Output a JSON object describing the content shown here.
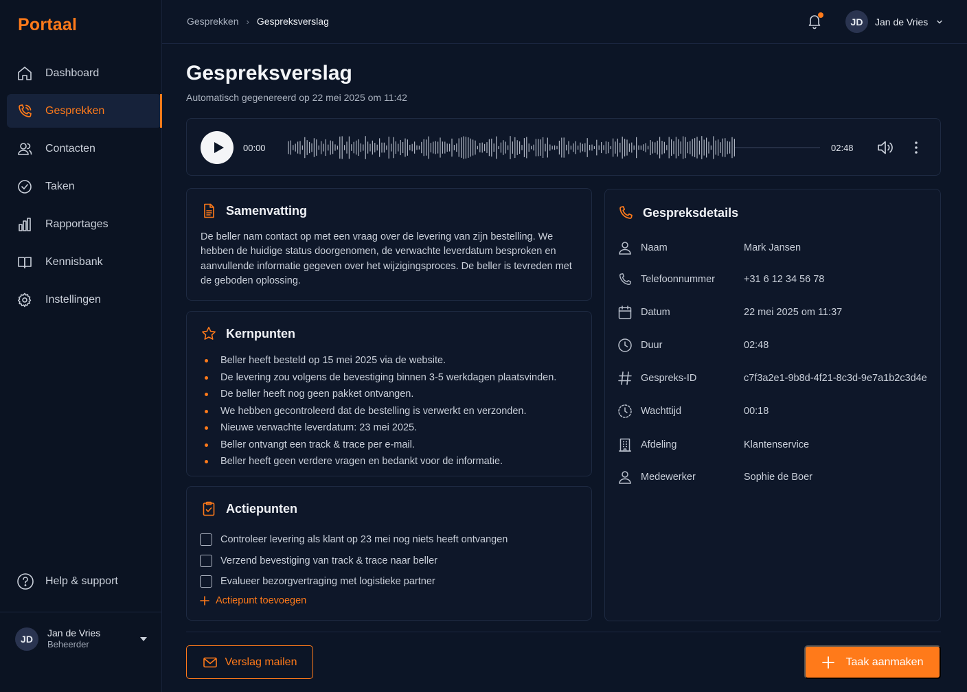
{
  "brand": "Portaal",
  "colors": {
    "accent": "#ff7a1a",
    "background": "#0c1526",
    "card": "#0e1729"
  },
  "sidebar": {
    "items": [
      {
        "label": "Dashboard",
        "icon": "home-icon",
        "active": false
      },
      {
        "label": "Gesprekken",
        "icon": "phone-call-icon",
        "active": true
      },
      {
        "label": "Contacten",
        "icon": "users-icon",
        "active": false
      },
      {
        "label": "Taken",
        "icon": "check-circle-icon",
        "active": false
      },
      {
        "label": "Rapportages",
        "icon": "bar-chart-icon",
        "active": false
      },
      {
        "label": "Kennisbank",
        "icon": "book-icon",
        "active": false
      },
      {
        "label": "Instellingen",
        "icon": "gear-icon",
        "active": false
      }
    ],
    "help": "Help & support",
    "user": {
      "initials": "JD",
      "name": "Jan de Vries",
      "role": "Beheerder"
    }
  },
  "topbar": {
    "breadcrumb": [
      "Gesprekken",
      "Gespreksverslag"
    ],
    "user": {
      "initials": "JD",
      "name": "Jan de Vries"
    }
  },
  "page": {
    "title": "Gespreksverslag",
    "subtitle": "Automatisch gegenereerd op 22 mei 2025 om 11:42"
  },
  "player": {
    "current_time": "00:00",
    "duration": "02:48",
    "progress": 0
  },
  "summary": {
    "title": "Samenvatting",
    "text": "De beller nam contact op met een vraag over de levering van zijn bestelling. We hebben de huidige status doorgenomen, de verwachte leverdatum besproken en aanvullende informatie gegeven over het wijzigingsproces. De beller is tevreden met de geboden oplossing."
  },
  "key_points": {
    "title": "Kernpunten",
    "items": [
      "Beller heeft besteld op 15 mei 2025 via de website.",
      "De levering zou volgens de bevestiging binnen 3-5 werkdagen plaatsvinden.",
      "De beller heeft nog geen pakket ontvangen.",
      "We hebben gecontroleerd dat de bestelling is verwerkt en verzonden.",
      "Nieuwe verwachte leverdatum: 23 mei 2025.",
      "Beller ontvangt een track & trace per e-mail.",
      "Beller heeft geen verdere vragen en bedankt voor de informatie."
    ]
  },
  "action_points": {
    "title": "Actiepunten",
    "items": [
      {
        "label": "Controleer levering als klant op 23 mei nog niets heeft ontvangen",
        "checked": false
      },
      {
        "label": "Verzend bevestiging van track & trace naar beller",
        "checked": false
      },
      {
        "label": "Evalueer bezorgvertraging met logistieke partner",
        "checked": false
      }
    ],
    "add_label": "Actiepunt toevoegen"
  },
  "details": {
    "title": "Gespreksdetails",
    "rows": [
      {
        "label": "Naam",
        "value": "Mark Jansen",
        "icon": "user-icon"
      },
      {
        "label": "Telefoonnummer",
        "value": "+31 6 12 34 56 78",
        "icon": "phone-icon"
      },
      {
        "label": "Datum",
        "value": "22 mei 2025 om 11:37",
        "icon": "calendar-icon"
      },
      {
        "label": "Duur",
        "value": "02:48",
        "icon": "clock-icon"
      },
      {
        "label": "Gespreks-ID",
        "value": "c7f3a2e1-9b8d-4f21-8c3d-9e7a1b2c3d4e",
        "icon": "hash-icon"
      },
      {
        "label": "Wachttijd",
        "value": "00:18",
        "icon": "timer-icon"
      },
      {
        "label": "Afdeling",
        "value": "Klantenservice",
        "icon": "building-icon"
      },
      {
        "label": "Medewerker",
        "value": "Sophie de Boer",
        "icon": "user-icon"
      }
    ]
  },
  "footer": {
    "mail_label": "Verslag mailen",
    "task_label": "Taak aanmaken"
  }
}
